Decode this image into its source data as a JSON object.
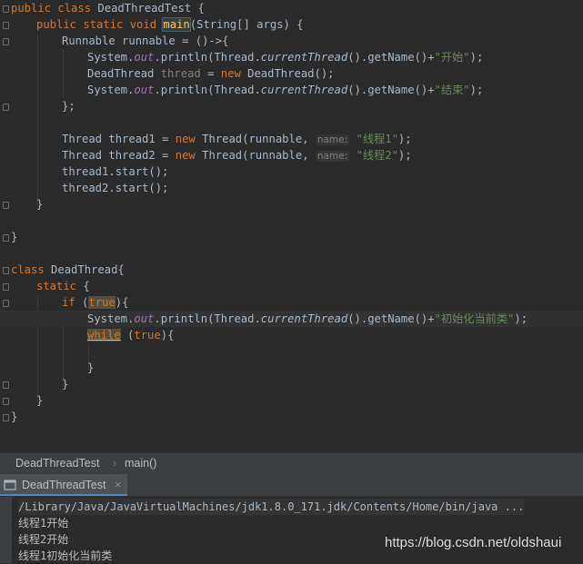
{
  "code": {
    "l1_kw": "public class ",
    "l1_name": "DeadThreadTest",
    "l1_brace": " {",
    "l2_kw": "public static void ",
    "l2_fn": "main",
    "l2_rest": "(String[] args) {",
    "l3": "Runnable runnable = ()->{",
    "l4_a": "System.",
    "l4_out": "out",
    "l4_b": ".println(Thread.",
    "l4_ct": "currentThread",
    "l4_c": "().getName()+",
    "l4_str": "\"开始\"",
    "l4_d": ");",
    "l5_a": "DeadThread ",
    "l5_var": "thread",
    "l5_b": " = ",
    "l5_new": "new",
    "l5_c": " DeadThread();",
    "l6_a": "System.",
    "l6_out": "out",
    "l6_b": ".println(Thread.",
    "l6_ct": "currentThread",
    "l6_c": "().getName()+",
    "l6_str": "\"结束\"",
    "l6_d": ");",
    "l7": "};",
    "l9_a": "Thread thread1 = ",
    "l9_new": "new",
    "l9_b": " Thread(runnable, ",
    "l9_hint": "name:",
    "l9_str": "\"线程1\"",
    "l9_c": ");",
    "l10_a": "Thread thread2 = ",
    "l10_new": "new",
    "l10_b": " Thread(runnable, ",
    "l10_hint": "name:",
    "l10_str": "\"线程2\"",
    "l10_c": ");",
    "l11": "thread1.start();",
    "l12": "thread2.start();",
    "l13": "}",
    "l15": "}",
    "l17_kw": "class ",
    "l17_name": "DeadThread",
    "l17_brace": "{",
    "l18_kw": "static",
    "l18_b": " {",
    "l19_kw": "if",
    "l19_a": " (",
    "l19_true": "true",
    "l19_b": "){",
    "l20_a": "System.",
    "l20_out": "out",
    "l20_b": ".println(Thread.",
    "l20_ct": "currentThread",
    "l20_c": "().getName()+",
    "l20_str": "\"初始化当前类\"",
    "l20_d": ");",
    "l21_kw": "while",
    "l21_a": " (",
    "l21_true": "true",
    "l21_b": "){",
    "l23": "}",
    "l24": "}",
    "l25": "}",
    "l26": "}"
  },
  "breadcrumb": {
    "class": "DeadThreadTest",
    "sep": "›",
    "method": "main()"
  },
  "run": {
    "tab": "DeadThreadTest",
    "close": "×"
  },
  "console": {
    "cmd": "/Library/Java/JavaVirtualMachines/jdk1.8.0_171.jdk/Contents/Home/bin/java ...",
    "out1": "线程1开始",
    "out2": "线程2开始",
    "out3": "线程1初始化当前类"
  },
  "watermark": "https://blog.csdn.net/oldshaui",
  "colors": {
    "keyword": "#cc7832",
    "string": "#6a8759",
    "static_field": "#9876aa",
    "method": "#ffc66d",
    "background": "#2b2b2b"
  }
}
